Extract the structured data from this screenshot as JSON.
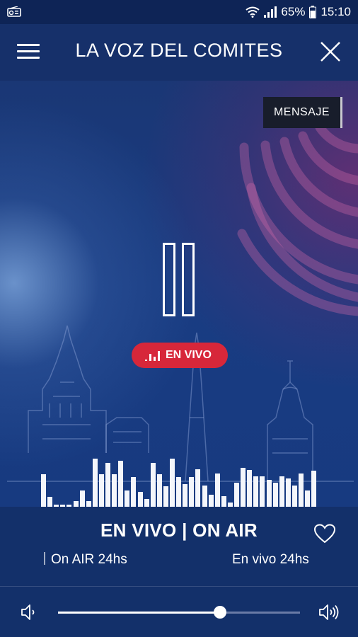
{
  "status_bar": {
    "battery": "65%",
    "time": "15:10"
  },
  "header": {
    "title": "LA VOZ DEL COMITES"
  },
  "mensaje_button": "MENSAJE",
  "live_badge": "EN VIVO",
  "now_playing": {
    "title": "EN VIVO | ON AIR",
    "ticker": [
      "On AIR 24hs",
      "En vivo 24hs"
    ]
  },
  "volume": {
    "level": 0.67
  },
  "equalizer_levels": [
    0.6,
    0.18,
    0.04,
    0.04,
    0.04,
    0.1,
    0.3,
    0.1,
    0.9,
    0.6,
    0.82,
    0.6,
    0.85,
    0.3,
    0.55,
    0.28,
    0.15,
    0.82,
    0.6,
    0.38,
    0.9,
    0.55,
    0.42,
    0.55,
    0.7,
    0.4,
    0.22,
    0.62,
    0.2,
    0.08,
    0.45,
    0.72,
    0.68,
    0.57,
    0.57,
    0.5,
    0.45,
    0.57,
    0.52,
    0.4,
    0.62,
    0.3,
    0.67
  ],
  "colors": {
    "accent_red": "#d7273a",
    "panel": "#13306a",
    "appbar": "#16306a"
  }
}
